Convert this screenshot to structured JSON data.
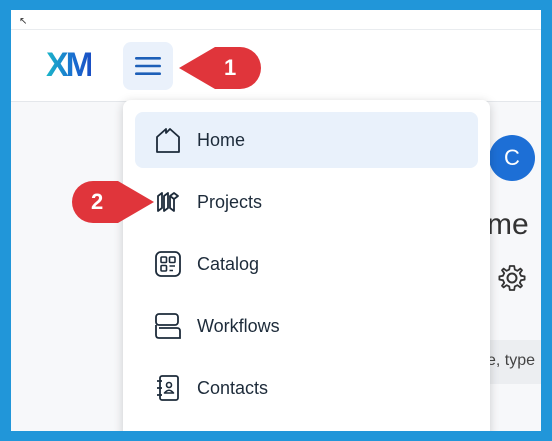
{
  "header": {
    "logo_text": "XM",
    "menu_button_icon": "hamburger-icon"
  },
  "callouts": [
    {
      "number": "1",
      "color": "#e0353b"
    },
    {
      "number": "2",
      "color": "#e0353b"
    }
  ],
  "nav_menu": {
    "items": [
      {
        "label": "Home",
        "icon": "home-icon",
        "active": true
      },
      {
        "label": "Projects",
        "icon": "projects-icon",
        "active": false
      },
      {
        "label": "Catalog",
        "icon": "catalog-icon",
        "active": false
      },
      {
        "label": "Workflows",
        "icon": "workflows-icon",
        "active": false
      },
      {
        "label": "Contacts",
        "icon": "contacts-icon",
        "active": false
      }
    ]
  },
  "background_page": {
    "avatar_initial": "C",
    "heading_fragment": "me",
    "search_fragment": "e, type"
  },
  "colors": {
    "frame": "#2196d9",
    "accent": "#1d6fd6",
    "active_item_bg": "#e9f1fb",
    "callout": "#e0353b"
  }
}
